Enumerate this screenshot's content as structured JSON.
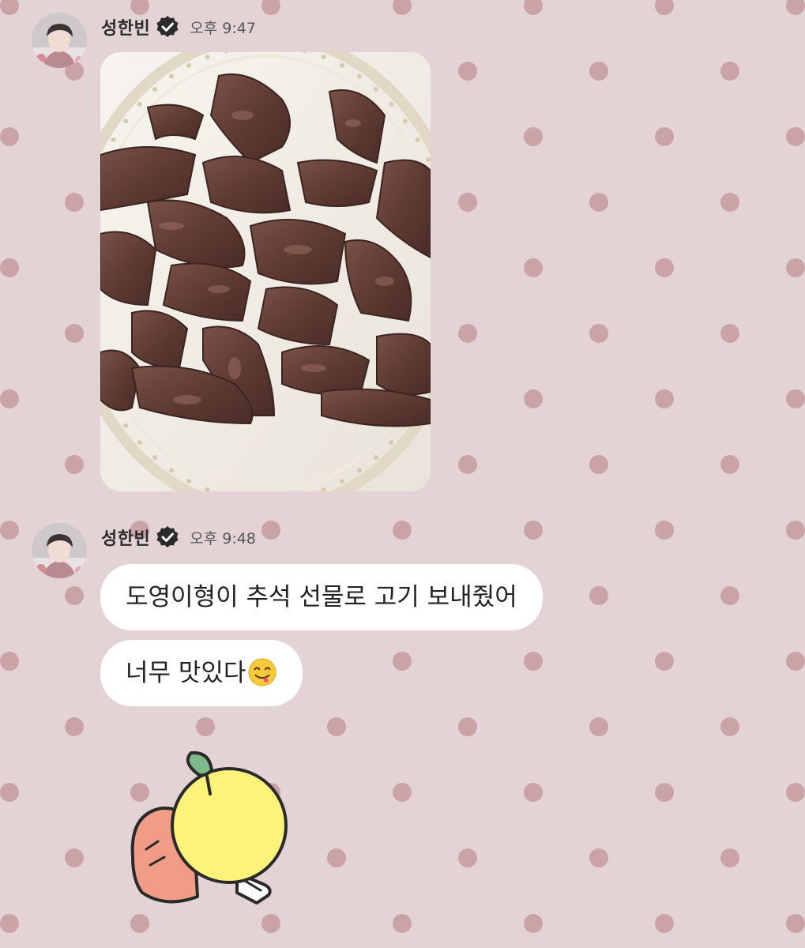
{
  "messages": [
    {
      "sender": "성한빈",
      "time": "오후 9:47",
      "kind": "photo",
      "icon": "verified-badge-icon",
      "image_subject": "sliced grilled beef on a white decorative plate"
    },
    {
      "sender": "성한빈",
      "time": "오후 9:48",
      "kind": "text",
      "icon": "verified-badge-icon",
      "bubbles": [
        "도영이형이 추석 선물로 고기 보내줬어",
        "너무 맛있다"
      ],
      "emoji": "yum-face-emoji"
    },
    {
      "kind": "sticker",
      "sticker": "yellow-lemon-character-sticker"
    }
  ],
  "colors": {
    "background": "#e4d3d4",
    "dot": "#c59a9f",
    "bubble": "#ffffff",
    "verified_badge": "#2b2b2b"
  }
}
